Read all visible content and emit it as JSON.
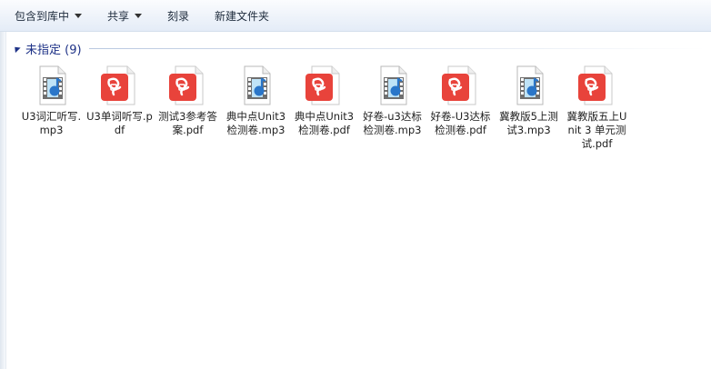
{
  "toolbar": {
    "include_library": "包含到库中",
    "share": "共享",
    "burn": "刻录",
    "new_folder": "新建文件夹"
  },
  "group": {
    "title": "未指定 (9)"
  },
  "files": [
    {
      "name": "U3词汇听写.mp3",
      "type": "mp3",
      "icon": "media-audio-icon"
    },
    {
      "name": "U3单词听写.pdf",
      "type": "pdf",
      "icon": "pdf-icon"
    },
    {
      "name": "测试3参考答案.pdf",
      "type": "pdf",
      "icon": "pdf-icon"
    },
    {
      "name": "典中点Unit3 检测卷.mp3",
      "type": "mp3",
      "icon": "media-audio-icon"
    },
    {
      "name": "典中点Unit3 检测卷.pdf",
      "type": "pdf",
      "icon": "pdf-icon"
    },
    {
      "name": "好卷-u3达标检测卷.mp3",
      "type": "mp3",
      "icon": "media-audio-icon"
    },
    {
      "name": "好卷-U3达标检测卷.pdf",
      "type": "pdf",
      "icon": "pdf-icon"
    },
    {
      "name": "冀教版5上测试3.mp3",
      "type": "mp3",
      "icon": "media-audio-icon"
    },
    {
      "name": "冀教版五上Unit 3 单元测试.pdf",
      "type": "pdf",
      "icon": "pdf-icon"
    }
  ],
  "colors": {
    "pdf_red": "#e8433b",
    "audio_blue": "#2a76c9",
    "group_title": "#1e3287"
  }
}
